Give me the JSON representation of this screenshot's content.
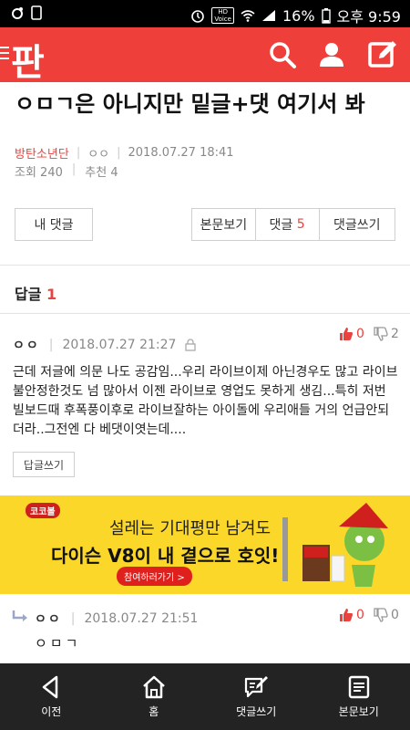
{
  "status_bar": {
    "battery_pct": "16%",
    "time": "오후 9:59",
    "hd_label": "HD",
    "voice_label": "Voice"
  },
  "header": {
    "logo": "판"
  },
  "post": {
    "title": "ㅇㅁㄱ은 아니지만 밑글+댓 여기서 봐",
    "author": "방탄소년단",
    "nickname": "ㅇㅇ",
    "date": "2018.07.27 18:41",
    "views": "조회 240",
    "recommends": "추천 4"
  },
  "actions": {
    "my_comments": "내 댓글",
    "view_post": "본문보기",
    "comments_label": "댓글",
    "comments_count": "5",
    "write_comment": "댓글쓰기"
  },
  "replies": {
    "label": "답글",
    "count": "1"
  },
  "comment1": {
    "nickname": "ㅇㅇ",
    "date": "2018.07.27 21:27",
    "up": "0",
    "down": "2",
    "body": "근데 저글에 의문 나도 공감임...우리 라이브이제 아닌경우도 많고 라이브불안정한것도 넘 많아서 이젠 라이브로 영업도 못하게 생김...특히 저번 빌보드때 후폭풍이후로 라이브잘하는 아이돌에 우리애들 거의 언급안되더라..그전엔 다 베댓이엿는데....",
    "reply_button": "답글쓰기"
  },
  "ad": {
    "brand": "코코볼",
    "line1": "설레는 기대평만 남겨도",
    "line2": "다이슨 V8이 내 곁으로 호잇!",
    "cta": "참여하러가기 >"
  },
  "comment2": {
    "nickname": "ㅇㅇ",
    "date": "2018.07.27 21:51",
    "up": "0",
    "down": "0",
    "body": "ㅇㅁㄱ"
  },
  "nav": {
    "prev": "이전",
    "home": "홈",
    "write_comment": "댓글쓰기",
    "view_post": "본문보기"
  },
  "colors": {
    "brand_red": "#ef3f3a",
    "accent_red": "#e8433e",
    "ad_yellow": "#fbd72a",
    "nav_dark": "#232323"
  }
}
